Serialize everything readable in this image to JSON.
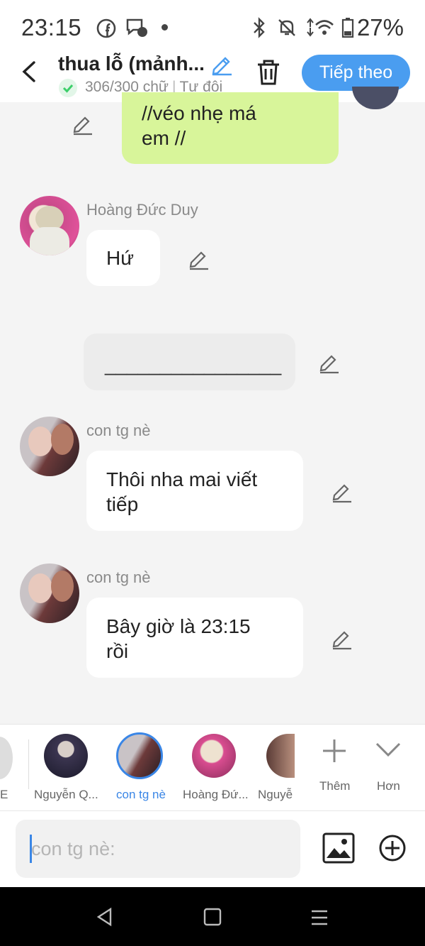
{
  "status": {
    "time": "23:15",
    "battery": "27%"
  },
  "header": {
    "title": "thua lỗ (mảnh...",
    "word_count": "306/300 chữ",
    "mode": "Tự đội",
    "next_label": "Tiếp theo"
  },
  "messages": [
    {
      "text_line1": "//véo nhẹ má",
      "text_line2": "em //"
    },
    {
      "sender": "Hoàng Đức Duy",
      "text": "Hứ"
    },
    {
      "text": "________________"
    },
    {
      "sender": "con tg nè",
      "text_line1": "Thôi nha mai viết",
      "text_line2": "tiếp"
    },
    {
      "sender": "con tg nè",
      "text_line1": "Bây giờ là 23:15",
      "text_line2": "rồi"
    }
  ],
  "characters": [
    {
      "label": "E"
    },
    {
      "label": "Nguyễn Q..."
    },
    {
      "label": "con tg nè"
    },
    {
      "label": "Hoàng Đứ..."
    },
    {
      "label": "Nguyễ"
    }
  ],
  "actions": {
    "add_label": "Thêm",
    "more_label": "Hơn"
  },
  "input": {
    "placeholder": "con tg nè:"
  },
  "colors": {
    "accent": "#4a9df0",
    "selected_char": "#3a86e6",
    "green_bubble": "#d8f59a",
    "check_green": "#3ccf6a"
  },
  "icons": [
    "facebook-icon",
    "messenger-icon",
    "bluetooth-icon",
    "mute-icon",
    "wifi-icon",
    "battery-icon",
    "back-icon",
    "pencil-icon",
    "trash-icon",
    "image-icon",
    "add-circle-icon",
    "plus-icon",
    "chevron-down-icon"
  ]
}
